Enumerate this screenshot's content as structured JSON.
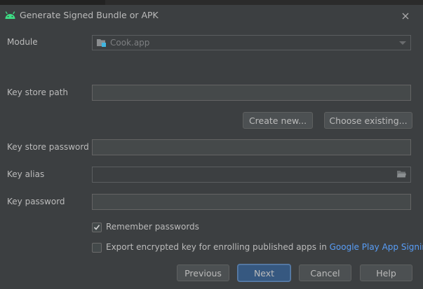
{
  "window": {
    "title": "Generate Signed Bundle or APK",
    "app_icon": "android-icon",
    "close_icon": "close-icon"
  },
  "form": {
    "module_label": "Module",
    "module_value": "Cook.app",
    "module_icon": "module-folder-icon",
    "key_store_path_label": "Key store path",
    "key_store_path_value": "",
    "create_new_label": "Create new...",
    "choose_existing_label": "Choose existing...",
    "key_store_password_label": "Key store password",
    "key_store_password_value": "",
    "key_alias_label": "Key alias",
    "key_alias_value": "",
    "key_password_label": "Key password",
    "key_password_value": "",
    "remember_passwords_label": "Remember passwords",
    "remember_passwords_checked": true,
    "export_key_label": "Export encrypted key for enrolling published apps in ",
    "export_key_link": "Google Play App Signing",
    "export_key_checked": false
  },
  "buttons": {
    "previous": "Previous",
    "next": "Next",
    "cancel": "Cancel",
    "help": "Help"
  },
  "colors": {
    "background": "#3c3f41",
    "text": "#bbbbbb",
    "link": "#589df6",
    "primary_button": "#365880",
    "android_green": "#3ddc84"
  }
}
